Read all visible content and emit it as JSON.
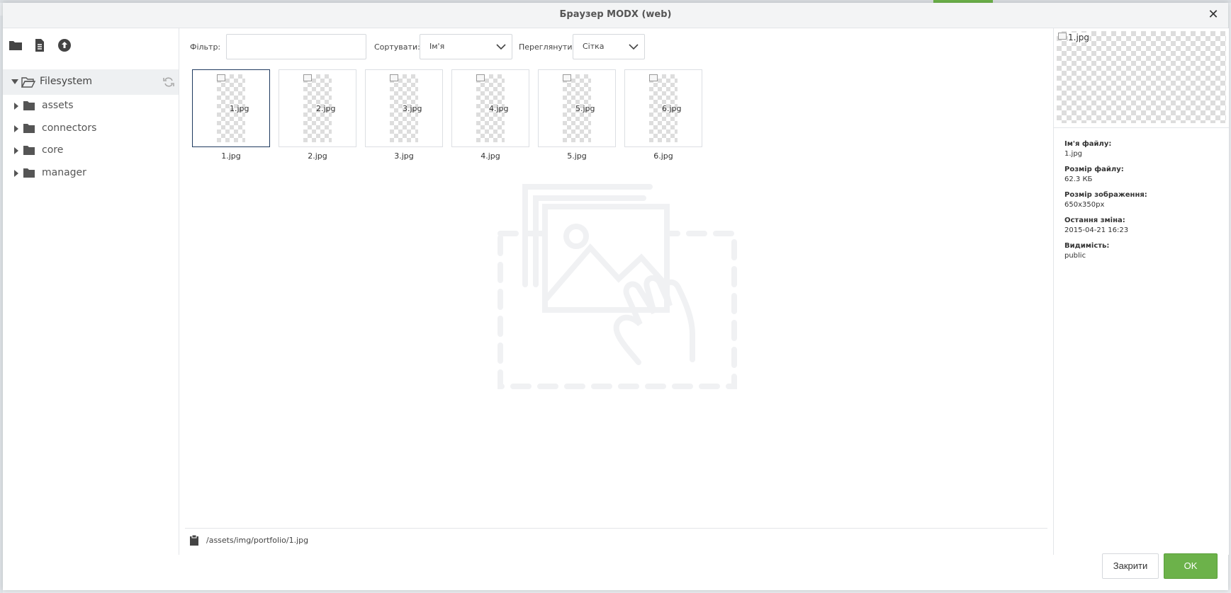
{
  "window": {
    "title": "Браузер MODX (web)",
    "close_icon": "close-icon"
  },
  "tree": {
    "root": "Filesystem",
    "items": [
      {
        "label": "assets"
      },
      {
        "label": "connectors"
      },
      {
        "label": "core"
      },
      {
        "label": "manager"
      }
    ]
  },
  "toolbar": {
    "filter_label": "Фільтр:",
    "filter_value": "",
    "sort_label": "Сортувати:",
    "sort_value": "Ім'я",
    "view_label": "Переглянути:",
    "view_value": "Сітка"
  },
  "files": [
    {
      "name": "1.jpg"
    },
    {
      "name": "2.jpg"
    },
    {
      "name": "3.jpg"
    },
    {
      "name": "4.jpg"
    },
    {
      "name": "5.jpg"
    },
    {
      "name": "6.jpg"
    }
  ],
  "path": "/assets/img/portfolio/1.jpg",
  "details": {
    "preview_alt": "1.jpg",
    "filename_label": "Ім'я файлу:",
    "filename": "1.jpg",
    "filesize_label": "Розмір файлу:",
    "filesize": "62.3 КБ",
    "imagesize_label": "Розмір зображення:",
    "imagesize": "650x350px",
    "modified_label": "Остання зміна:",
    "modified": "2015-04-21 16:23",
    "visibility_label": "Видимість:",
    "visibility": "public"
  },
  "buttons": {
    "close": "Закрити",
    "ok": "OK"
  },
  "colors": {
    "accent": "#6cb24a",
    "selected_border": "#1f3a5f"
  }
}
